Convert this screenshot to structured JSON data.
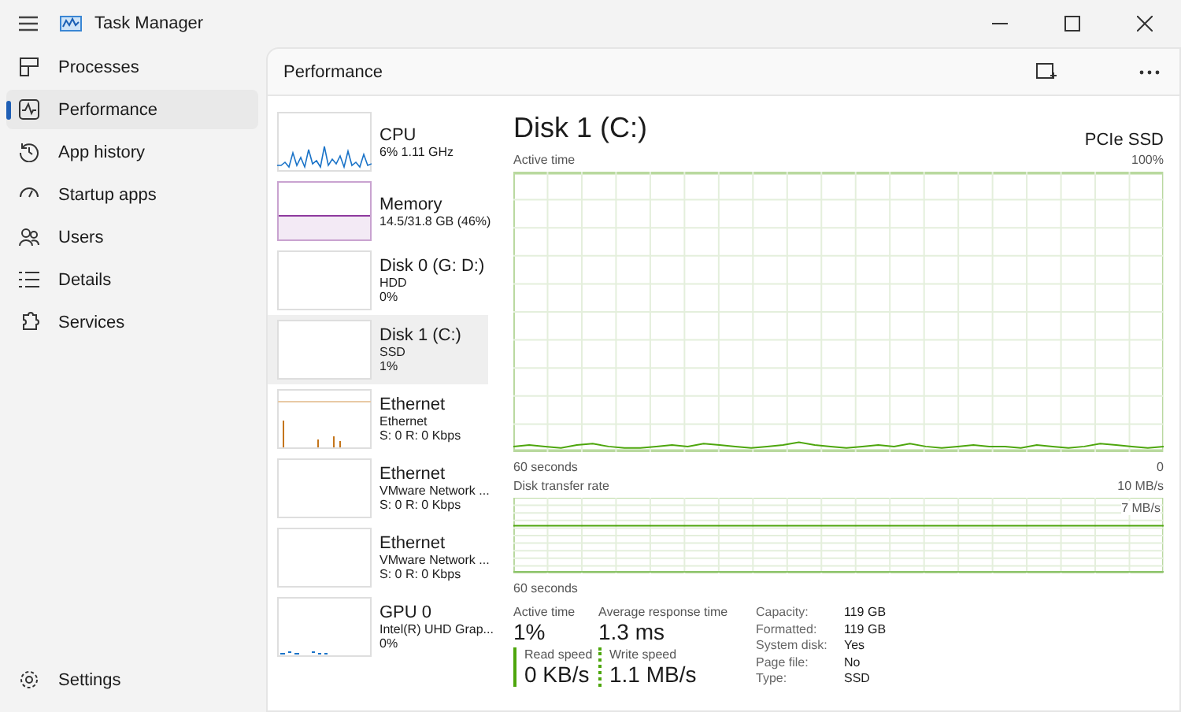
{
  "window": {
    "title": "Task Manager"
  },
  "sidebar": {
    "items": [
      {
        "label": "Processes",
        "selected": false
      },
      {
        "label": "Performance",
        "selected": true
      },
      {
        "label": "App history",
        "selected": false
      },
      {
        "label": "Startup apps",
        "selected": false
      },
      {
        "label": "Users",
        "selected": false
      },
      {
        "label": "Details",
        "selected": false
      },
      {
        "label": "Services",
        "selected": false
      }
    ],
    "settings": {
      "label": "Settings"
    }
  },
  "header": {
    "title": "Performance"
  },
  "devices": [
    {
      "name": "CPU",
      "line1": "6% 1.11 GHz",
      "kind": "cpu",
      "selected": false
    },
    {
      "name": "Memory",
      "line1": "14.5/31.8 GB (46%)",
      "kind": "memory",
      "selected": false
    },
    {
      "name": "Disk 0 (G: D:)",
      "line1": "HDD",
      "line2": "0%",
      "kind": "disk",
      "selected": false
    },
    {
      "name": "Disk 1 (C:)",
      "line1": "SSD",
      "line2": "1%",
      "kind": "disk",
      "selected": true
    },
    {
      "name": "Ethernet",
      "line1": "Ethernet",
      "line2": "S: 0 R: 0 Kbps",
      "kind": "ethernet",
      "selected": false
    },
    {
      "name": "Ethernet",
      "line1": "VMware Network ...",
      "line2": "S: 0 R: 0 Kbps",
      "kind": "idle",
      "selected": false
    },
    {
      "name": "Ethernet",
      "line1": "VMware Network ...",
      "line2": "S: 0 R: 0 Kbps",
      "kind": "idle",
      "selected": false
    },
    {
      "name": "GPU 0",
      "line1": "Intel(R) UHD Grap...",
      "line2": "0%",
      "kind": "gpu",
      "selected": false
    }
  ],
  "detail": {
    "title": "Disk 1 (C:)",
    "model": "PCIe SSD",
    "charts": [
      {
        "label": "Active time",
        "max": "100%",
        "span": "60 seconds",
        "min": "0",
        "kind": "active"
      },
      {
        "label": "Disk transfer rate",
        "max": "10 MB/s",
        "inner": "7 MB/s",
        "span": "60 seconds",
        "kind": "transfer"
      }
    ],
    "stats": [
      {
        "label": "Active time",
        "value": "1%",
        "kind": "plain"
      },
      {
        "label": "Average response time",
        "value": "1.3 ms",
        "kind": "plain"
      },
      {
        "label": "Read speed",
        "value": "0 KB/s",
        "kind": "solid"
      },
      {
        "label": "Write speed",
        "value": "1.1 MB/s",
        "kind": "dotted"
      }
    ],
    "properties": [
      {
        "label": "Capacity:",
        "value": "119 GB"
      },
      {
        "label": "Formatted:",
        "value": "119 GB"
      },
      {
        "label": "System disk:",
        "value": "Yes"
      },
      {
        "label": "Page file:",
        "value": "No"
      },
      {
        "label": "Type:",
        "value": "SSD"
      }
    ]
  }
}
